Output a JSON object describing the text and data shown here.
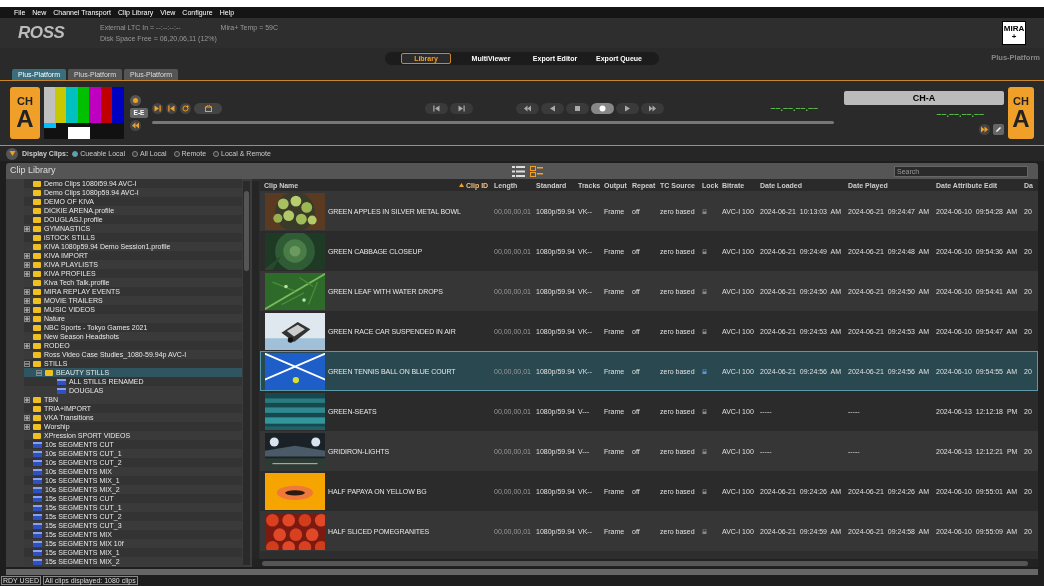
{
  "menu": [
    "File",
    "New",
    "Channel Transport",
    "Clip Library",
    "View",
    "Configure",
    "Help"
  ],
  "header": {
    "logo": "ROSS",
    "ltc": "External LTC In = --:--:--:--",
    "temp": "Mira+ Temp = 59C",
    "disk": "Disk Space Free = 06,20,06,11 (12%)",
    "badge_top": "MIRA",
    "badge_bottom": "+"
  },
  "nav_tabs": [
    {
      "label": "Library",
      "selected": true
    },
    {
      "label": "MultiViewer",
      "selected": false
    },
    {
      "label": "Export Editor",
      "selected": false
    },
    {
      "label": "Export Queue",
      "selected": false
    }
  ],
  "platform_name": "Plus-Platform",
  "platform_tabs": [
    {
      "label": "Plus-Platform",
      "selected": true
    },
    {
      "label": "Plus-Platform",
      "selected": false
    },
    {
      "label": "Plus-Platform",
      "selected": false
    }
  ],
  "channel": {
    "badge_top": "CH",
    "badge_bottom": "A",
    "ee_label": "E-E",
    "timecode_1": "––.––.––.––",
    "name": "CH-A",
    "timecode_2": "––.––.––.––",
    "badge_right_top": "CH",
    "badge_right_bottom": "A"
  },
  "display_clips": {
    "label": "Display Clips:",
    "options": [
      {
        "label": "Cueable Local",
        "selected": true
      },
      {
        "label": "All Local",
        "selected": false
      },
      {
        "label": "Remote",
        "selected": false
      },
      {
        "label": "Local & Remote",
        "selected": false
      }
    ]
  },
  "library": {
    "title": "Clip Library",
    "views": [
      {
        "kind": "list",
        "selected": false
      },
      {
        "kind": "grid",
        "selected": true
      }
    ],
    "search": {
      "placeholder": "Search"
    }
  },
  "tree": [
    {
      "label": "Demo Clips 1080i59.94 AVC-I",
      "kind": "folder",
      "selected": false
    },
    {
      "label": "Demo Clips 1080p59.94 AVC-I",
      "kind": "folder",
      "selected": false
    },
    {
      "label": "DEMO OF KIVA",
      "kind": "folder",
      "selected": false
    },
    {
      "label": "DICKIE ARENA.profile",
      "kind": "folder",
      "selected": false
    },
    {
      "label": "DOUGLASJ.profile",
      "kind": "folder",
      "selected": false
    },
    {
      "label": "GYMNASTICS",
      "kind": "folder",
      "expanded": false,
      "selected": false
    },
    {
      "label": "iSTOCK STILLS",
      "kind": "folder",
      "selected": false
    },
    {
      "label": "KIVA 1080p59.94 Demo Session1.profile",
      "kind": "folder",
      "selected": false
    },
    {
      "label": "KIVA IMPORT",
      "kind": "folder",
      "expanded": false,
      "selected": false
    },
    {
      "label": "KIVA PLAYLISTS",
      "kind": "folder",
      "expanded": false,
      "selected": false
    },
    {
      "label": "KIVA PROFILES",
      "kind": "folder",
      "expanded": false,
      "selected": false
    },
    {
      "label": "Kiva Tech Talk.profile",
      "kind": "folder",
      "selected": false
    },
    {
      "label": "MIRA REPLAY EVENTS",
      "kind": "folder",
      "expanded": false,
      "selected": false
    },
    {
      "label": "MOVIE TRAILERS",
      "kind": "folder",
      "expanded": false,
      "selected": false
    },
    {
      "label": "MUSIC VIDEOS",
      "kind": "folder",
      "expanded": false,
      "selected": false
    },
    {
      "label": "Nature",
      "kind": "folder",
      "expanded": false,
      "selected": false
    },
    {
      "label": "NBC Sports - Tokyo Games 2021",
      "kind": "folder",
      "selected": false
    },
    {
      "label": "New Season Headshots",
      "kind": "folder",
      "selected": false
    },
    {
      "label": "RODEO",
      "kind": "folder",
      "expanded": false,
      "selected": false
    },
    {
      "label": "Ross Video Case Studies_1080-59.94p AVC-I",
      "kind": "folder",
      "selected": false
    },
    {
      "label": "STILLS",
      "kind": "folder",
      "expanded": true,
      "selected": false,
      "children": [
        {
          "label": "BEAUTY STILLS",
          "kind": "folder",
          "expanded": true,
          "selected": true,
          "children": [
            {
              "label": "ALL STILLS RENAMED",
              "kind": "clip",
              "selected": false
            },
            {
              "label": "DOUGLAS",
              "kind": "clip",
              "selected": false
            }
          ]
        }
      ]
    },
    {
      "label": "TBN",
      "kind": "folder",
      "expanded": false,
      "selected": false
    },
    {
      "label": "TRIA+IMPORT",
      "kind": "folder",
      "selected": false
    },
    {
      "label": "VKA Transitions",
      "kind": "folder",
      "expanded": false,
      "selected": false
    },
    {
      "label": "Worship",
      "kind": "folder",
      "expanded": false,
      "selected": false
    },
    {
      "label": "XPression SPORT VIDEOS",
      "kind": "folder",
      "selected": false
    },
    {
      "label": "10s SEGMENTS CUT",
      "kind": "clip",
      "selected": false
    },
    {
      "label": "10s SEGMENTS CUT_1",
      "kind": "clip",
      "selected": false
    },
    {
      "label": "10s SEGMENTS CUT_2",
      "kind": "clip",
      "selected": false
    },
    {
      "label": "10s SEGMENTS MIX",
      "kind": "clip",
      "selected": false
    },
    {
      "label": "10s SEGMENTS MIX_1",
      "kind": "clip",
      "selected": false
    },
    {
      "label": "10s SEGMENTS MIX_2",
      "kind": "clip",
      "selected": false
    },
    {
      "label": "15s SEGMENTS CUT",
      "kind": "clip",
      "selected": false
    },
    {
      "label": "15s SEGMENTS CUT_1",
      "kind": "clip",
      "selected": false
    },
    {
      "label": "15s SEGMENTS CUT_2",
      "kind": "clip",
      "selected": false
    },
    {
      "label": "15s SEGMENTS CUT_3",
      "kind": "clip",
      "selected": false
    },
    {
      "label": "15s SEGMENTS MIX",
      "kind": "clip",
      "selected": false
    },
    {
      "label": "15s SEGMENTS MIX 10f",
      "kind": "clip",
      "selected": false
    },
    {
      "label": "15s SEGMENTS MIX_1",
      "kind": "clip",
      "selected": false
    },
    {
      "label": "15s SEGMENTS MIX_2",
      "kind": "clip",
      "selected": false
    }
  ],
  "table": {
    "columns": [
      {
        "label": "Clip Name",
        "sorted": false
      },
      {
        "label": "Clip ID",
        "sorted": true
      },
      {
        "label": "Length",
        "sorted": false
      },
      {
        "label": "Standard",
        "sorted": false
      },
      {
        "label": "Tracks",
        "sorted": false
      },
      {
        "label": "Output",
        "sorted": false
      },
      {
        "label": "Repeat",
        "sorted": false
      },
      {
        "label": "TC Source",
        "sorted": false
      },
      {
        "label": "Lock",
        "sorted": false
      },
      {
        "label": "Bitrate",
        "sorted": false
      },
      {
        "label": "Date Loaded",
        "sorted": false
      },
      {
        "label": "Date Played",
        "sorted": false
      },
      {
        "label": "Date Attribute Edit",
        "sorted": false
      },
      {
        "label": "Da",
        "sorted": false
      }
    ],
    "rows": [
      {
        "name": "GREEN APPLES IN SILVER METAL BOWL",
        "length": "00,00,00,01",
        "standard": "1080p/59.94",
        "tracks": "VK--",
        "output": "Frame",
        "repeat": "off",
        "tc_source": "zero based",
        "bitrate": "AVC-I 100",
        "date_loaded": "2024-06-21 10:13:03 AM",
        "date_played": "2024-06-21 09:24:47 AM",
        "date_attribute_edit": "2024-06-10 09:54:28 AM",
        "column_14": "20",
        "selected": false
      },
      {
        "name": "GREEN CABBAGE CLOSEUP",
        "length": "00,00,00,01",
        "standard": "1080p/59.94",
        "tracks": "VK--",
        "output": "Frame",
        "repeat": "off",
        "tc_source": "zero based",
        "bitrate": "AVC-I 100",
        "date_loaded": "2024-06-21 09:24:49 AM",
        "date_played": "2024-06-21 09:24:48 AM",
        "date_attribute_edit": "2024-06-10 09:54:36 AM",
        "column_14": "20",
        "selected": false
      },
      {
        "name": "GREEN LEAF WITH WATER DROPS",
        "length": "00,00,00,01",
        "standard": "1080p/59.94",
        "tracks": "VK--",
        "output": "Frame",
        "repeat": "off",
        "tc_source": "zero based",
        "bitrate": "AVC-I 100",
        "date_loaded": "2024-06-21 09:24:50 AM",
        "date_played": "2024-06-21 09:24:50 AM",
        "date_attribute_edit": "2024-06-10 09:54:41 AM",
        "column_14": "20",
        "selected": false
      },
      {
        "name": "GREEN RACE CAR SUSPENDED IN AIR",
        "length": "00,00,00,01",
        "standard": "1080p/59.94",
        "tracks": "VK--",
        "output": "Frame",
        "repeat": "off",
        "tc_source": "zero based",
        "bitrate": "AVC-I 100",
        "date_loaded": "2024-06-21 09:24:53 AM",
        "date_played": "2024-06-21 09:24:53 AM",
        "date_attribute_edit": "2024-06-10 09:54:47 AM",
        "column_14": "20",
        "selected": false
      },
      {
        "name": "GREEN TENNIS BALL ON BLUE COURT",
        "length": "00,00,00,01",
        "standard": "1080p/59.94",
        "tracks": "VK--",
        "output": "Frame",
        "repeat": "off",
        "tc_source": "zero based",
        "bitrate": "AVC-I 100",
        "date_loaded": "2024-06-21 09:24:56 AM",
        "date_played": "2024-06-21 09:24:56 AM",
        "date_attribute_edit": "2024-06-10 09:54:55 AM",
        "column_14": "20",
        "selected": true
      },
      {
        "name": "GREEN-SEATS",
        "length": "00,00,00,01",
        "standard": "1080p/59.94",
        "tracks": "V---",
        "output": "Frame",
        "repeat": "off",
        "tc_source": "zero based",
        "bitrate": "AVC-I 100",
        "date_loaded": "-----",
        "date_played": "-----",
        "date_attribute_edit": "2024-06-13 12:12:18 PM",
        "column_14": "20",
        "selected": false
      },
      {
        "name": "GRIDIRON-LIGHTS",
        "length": "00,00,00,01",
        "standard": "1080p/59.94",
        "tracks": "V---",
        "output": "Frame",
        "repeat": "off",
        "tc_source": "zero based",
        "bitrate": "AVC-I 100",
        "date_loaded": "-----",
        "date_played": "-----",
        "date_attribute_edit": "2024-06-13 12:12:21 PM",
        "column_14": "20",
        "selected": false
      },
      {
        "name": "HALF PAPAYA ON YELLOW BG",
        "length": "00,00,00,01",
        "standard": "1080p/59.94",
        "tracks": "VK--",
        "output": "Frame",
        "repeat": "off",
        "tc_source": "zero based",
        "bitrate": "AVC-I 100",
        "date_loaded": "2024-06-21 09:24:26 AM",
        "date_played": "2024-06-21 09:24:26 AM",
        "date_attribute_edit": "2024-06-10 09:55:01 AM",
        "column_14": "20",
        "selected": false
      },
      {
        "name": "HALF SLICED POMEGRANITES",
        "length": "00,00,00,01",
        "standard": "1080p/59.94",
        "tracks": "VK--",
        "output": "Frame",
        "repeat": "off",
        "tc_source": "zero based",
        "bitrate": "AVC-I 100",
        "date_loaded": "2024-06-21 09:24:59 AM",
        "date_played": "2024-06-21 09:24:58 AM",
        "date_attribute_edit": "2024-06-10 09:55:09 AM",
        "column_14": "20",
        "selected": false
      }
    ]
  },
  "status_bar": {
    "state": "RDY USED",
    "message": "All clips displayed: 1080 clips"
  }
}
